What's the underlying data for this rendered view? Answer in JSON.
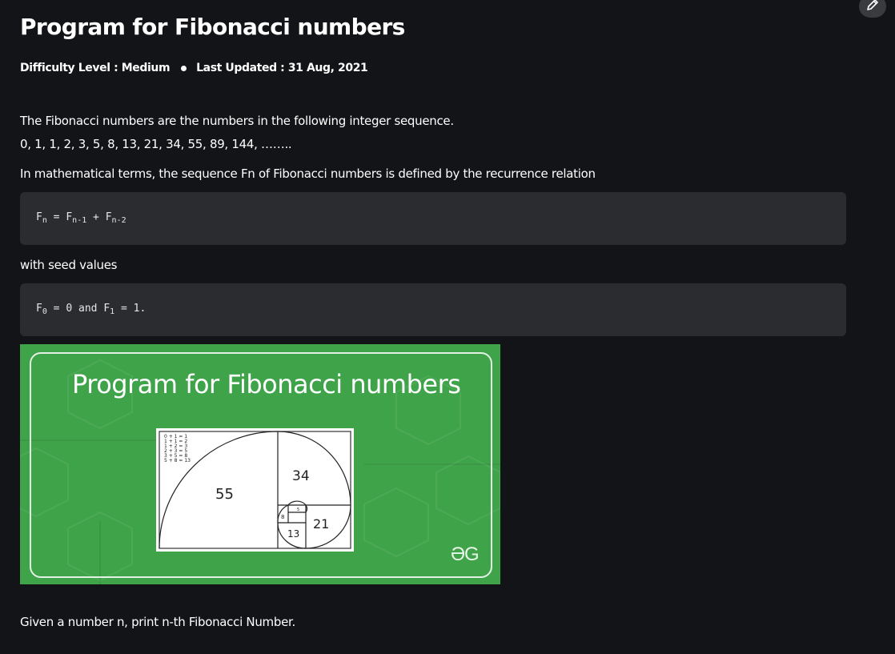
{
  "article": {
    "title": "Program for Fibonacci numbers",
    "difficulty": "Difficulty Level : Medium",
    "last_updated": "Last Updated : 31 Aug, 2021"
  },
  "content": {
    "intro": "The Fibonacci numbers are the numbers in the following integer sequence.",
    "sequence": "0, 1, 1, 2, 3, 5, 8, 13, 21, 34, 55, 89, 144, ……..",
    "definition": "In mathematical terms, the sequence Fn of Fibonacci numbers is defined by the recurrence relation",
    "seed_label": "with seed values",
    "task": "Given a number n, print n-th Fibonacci Number."
  },
  "code1": {
    "f": "F",
    "n": "n",
    "eq": " = ",
    "f1": "F",
    "n1": "n-1",
    "plus": " + ",
    "f2": "F",
    "n2": "n-2"
  },
  "code2": {
    "f0": "F",
    "s0": "0",
    "eq0": " = 0 and ",
    "f1": "F",
    "s1": "1",
    "eq1": " = 1."
  },
  "banner": {
    "title": "Program for Fibonacci numbers",
    "logo": "ƏG",
    "spiral_labels": [
      "55",
      "34",
      "21",
      "13",
      "8",
      "5"
    ],
    "sums": [
      "0 + 1 = 1",
      "1 + 1 = 2",
      "1 + 2 = 3",
      "2 + 3 = 5",
      "3 + 5 = 8",
      "5 + 8 = 13"
    ],
    "background_color": "#3fa34a"
  },
  "icons": {
    "edit": "pencil-icon"
  }
}
